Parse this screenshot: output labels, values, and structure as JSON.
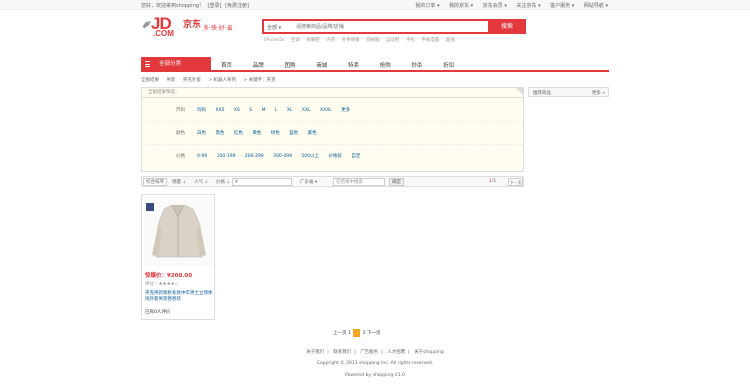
{
  "topbar": {
    "left": [
      "您好，欢迎来到shopping！",
      "[登录]",
      "[免费注册]"
    ],
    "right": [
      "我的订单 ▾",
      "我的京东 ▾",
      "京东会员 ▾",
      "关注京东 ▾",
      "客户服务 ▾",
      "网站导航 ▾"
    ]
  },
  "logo": {
    "text": "JD",
    "com": ".COM",
    "cn": "京东",
    "slogan": "多·快·好·省"
  },
  "search": {
    "category": "全部 ▾",
    "placeholder": "请搜索商品/品牌/店铺",
    "button": "搜索"
  },
  "hotwords": [
    "iPhone5s",
    "空调",
    "保暖鞋",
    "内衣",
    "冬季保暖",
    "羽绒服",
    "运动鞋",
    "手机",
    "平板电脑",
    "超值"
  ],
  "nav": {
    "all_categories": "全部分类",
    "items": [
      "首页",
      "品牌",
      "团购",
      "商城",
      "特卖",
      "抢购",
      "秒杀",
      "折扣"
    ]
  },
  "breadcrumb": [
    "全部结果",
    "男装",
    "夹克外套",
    "> 机器人系列",
    "> 关键字：夹克"
  ],
  "filter": {
    "header": "全部结果筛选：",
    "rows": [
      {
        "label": "尺码",
        "values": [
          "均码",
          "XXS",
          "XS",
          "S",
          "M",
          "L",
          "XL",
          "XXL",
          "XXXL",
          "更多"
        ]
      },
      {
        "label": "颜色",
        "values": [
          "白色",
          "黑色",
          "红色",
          "黄色",
          "绿色",
          "蓝色",
          "紫色"
        ]
      },
      {
        "label": "价格",
        "values": [
          "0-99",
          "100-199",
          "200-299",
          "300-499",
          "500以上",
          "价格段",
          "自定"
        ]
      }
    ]
  },
  "right_panel": {
    "title": "推荐商品",
    "more": "更多 »"
  },
  "sortbar": {
    "default": "综合排序",
    "sales": "销量 ⇣",
    "popular": "人气 ⇣",
    "price": "价格 ⇣",
    "price_from": "¥",
    "price_to": "¥",
    "ship_to": "广东省 ▾",
    "keyword_placeholder": "在结果中搜索",
    "confirm": "确定",
    "page": "1",
    "total": "/1",
    "next": "下一页"
  },
  "product": {
    "price": "惊爆价：¥208.00",
    "stars": "评分：★★★★☆",
    "desc": "夹克男新款秋冬款中年男士立领休闲外套男装爸爸装",
    "footer": "已有0人评价"
  },
  "pager": {
    "prev": "上一页",
    "first": "1",
    "current": "2",
    "next_page": "下一页"
  },
  "footer": {
    "links": [
      "关于我们",
      "联系我们",
      "广告服务",
      "人才招聘",
      "关于shopping"
    ],
    "copyright": "Copyright © 2013 shopping Inc. All rights reserved.",
    "powered": "Powered by shopping V1.0"
  }
}
